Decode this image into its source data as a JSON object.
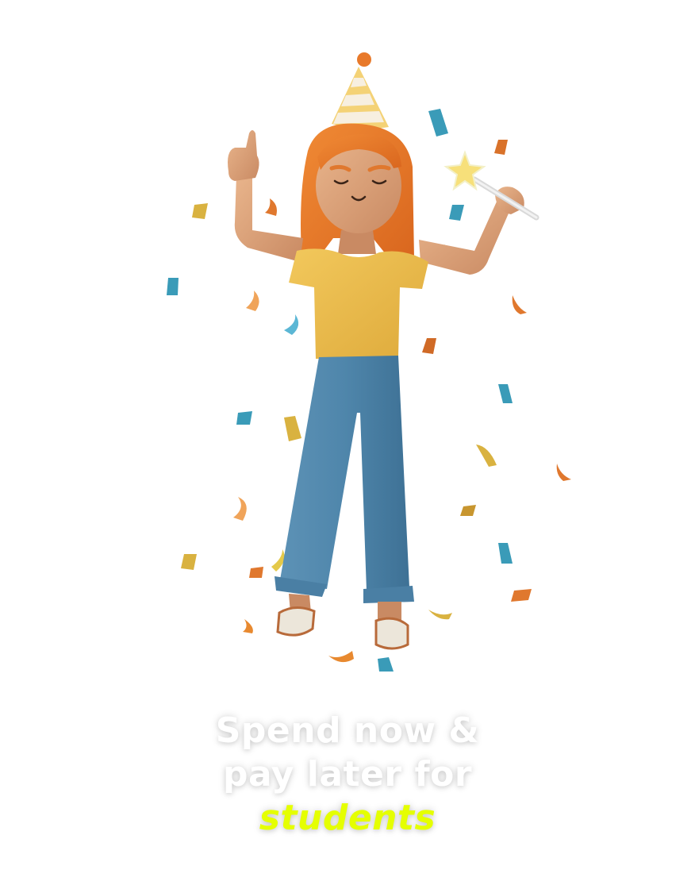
{
  "hero": {
    "illustration": "celebrating-girl-with-party-hat-and-sparkler-icon",
    "confetti_colors": [
      "#e8892f",
      "#3a9bb8",
      "#e4b842",
      "#f0a45a"
    ]
  },
  "headline": {
    "line1": "Spend now &",
    "line2": "pay later for",
    "accent": "students",
    "text_color": "#ffffff",
    "accent_color": "#e5ff00"
  }
}
